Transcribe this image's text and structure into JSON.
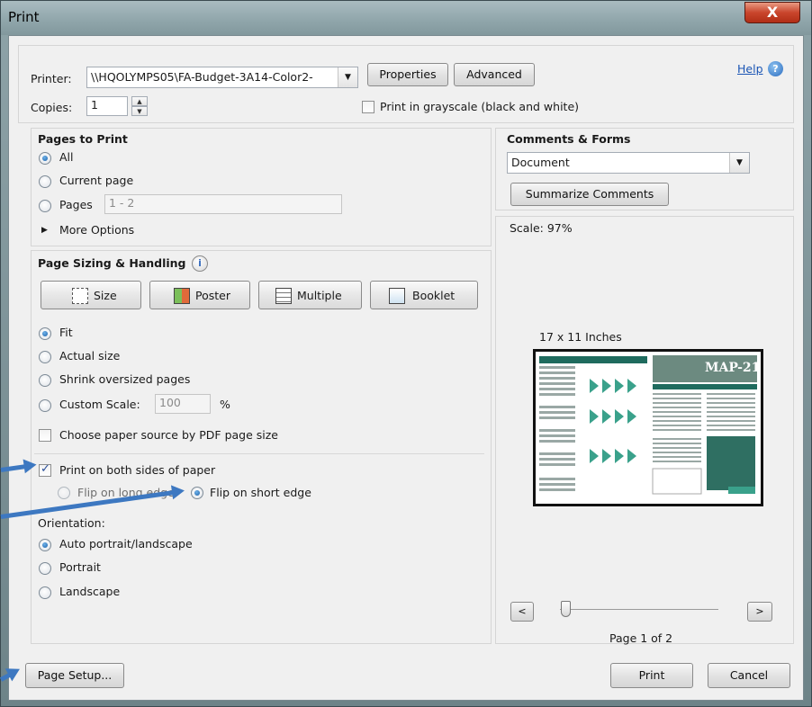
{
  "window": {
    "title": "Print",
    "close_label": "X"
  },
  "top": {
    "printer_label": "Printer:",
    "printer_value": "\\\\HQOLYMPS05\\FA-Budget-3A14-Color2-",
    "properties_label": "Properties",
    "advanced_label": "Advanced",
    "help_label": "Help",
    "copies_label": "Copies:",
    "copies_value": "1",
    "grayscale_label": "Print in grayscale (black and white)"
  },
  "pages_to_print": {
    "heading": "Pages to Print",
    "all_label": "All",
    "current_label": "Current page",
    "pages_label": "Pages",
    "pages_value": "1 - 2",
    "more_options_label": "More Options"
  },
  "sizing": {
    "heading": "Page Sizing & Handling",
    "size_label": "Size",
    "poster_label": "Poster",
    "multiple_label": "Multiple",
    "booklet_label": "Booklet",
    "fit_label": "Fit",
    "actual_label": "Actual size",
    "shrink_label": "Shrink oversized pages",
    "custom_label": "Custom Scale:",
    "custom_value": "100",
    "percent_label": "%",
    "paper_source_label": "Choose paper source by PDF page size",
    "both_sides_label": "Print on both sides of paper",
    "long_edge_label": "Flip on long edge",
    "short_edge_label": "Flip on short edge"
  },
  "orientation": {
    "heading": "Orientation:",
    "auto_label": "Auto portrait/landscape",
    "portrait_label": "Portrait",
    "landscape_label": "Landscape"
  },
  "comments": {
    "heading": "Comments & Forms",
    "value": "Document",
    "summarize_label": "Summarize Comments"
  },
  "preview": {
    "scale_label": "Scale: 97%",
    "size_label": "17 x 11 Inches",
    "map_label": "MAP-21",
    "page_label": "Page 1 of 2",
    "prev_label": "<",
    "next_label": ">"
  },
  "footer": {
    "page_setup_label": "Page Setup...",
    "print_label": "Print",
    "cancel_label": "Cancel"
  }
}
